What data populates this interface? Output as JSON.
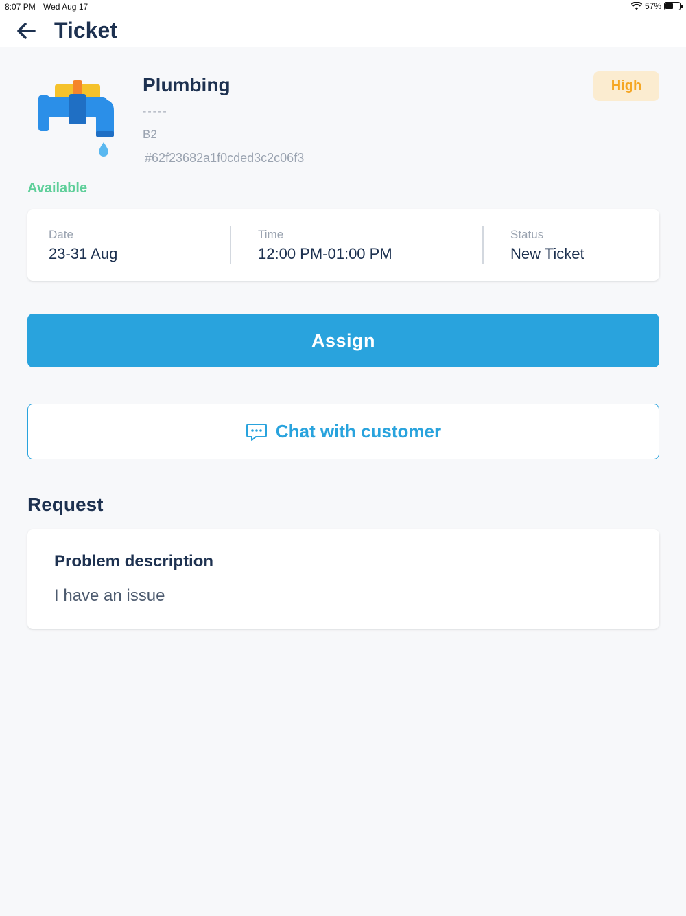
{
  "status_bar": {
    "time": "8:07 PM",
    "date": "Wed Aug 17",
    "battery": "57%",
    "battery_level": 0.57
  },
  "header": {
    "title": "Ticket",
    "back_icon": "arrow-left-icon"
  },
  "ticket": {
    "service_icon": "faucet-icon",
    "category": "Plumbing",
    "subtitle": "-----",
    "unit": "B2",
    "id": "#62f23682a1f0cded3c2c06f3",
    "priority": "High",
    "availability": "Available"
  },
  "info": {
    "date_label": "Date",
    "date_value": "23-31 Aug",
    "time_label": "Time",
    "time_value": "12:00 PM-01:00 PM",
    "status_label": "Status",
    "status_value": "New Ticket"
  },
  "actions": {
    "assign_label": "Assign",
    "chat_label": "Chat with customer",
    "chat_icon": "chat-bubble-icon"
  },
  "request": {
    "section_title": "Request",
    "problem_label": "Problem description",
    "problem_text": "I have an issue"
  },
  "colors": {
    "primary": "#29a3dd",
    "text_dark": "#1d3150",
    "available": "#5fcf9a",
    "priority_bg": "#fbecd0",
    "priority_text": "#f5a623"
  }
}
